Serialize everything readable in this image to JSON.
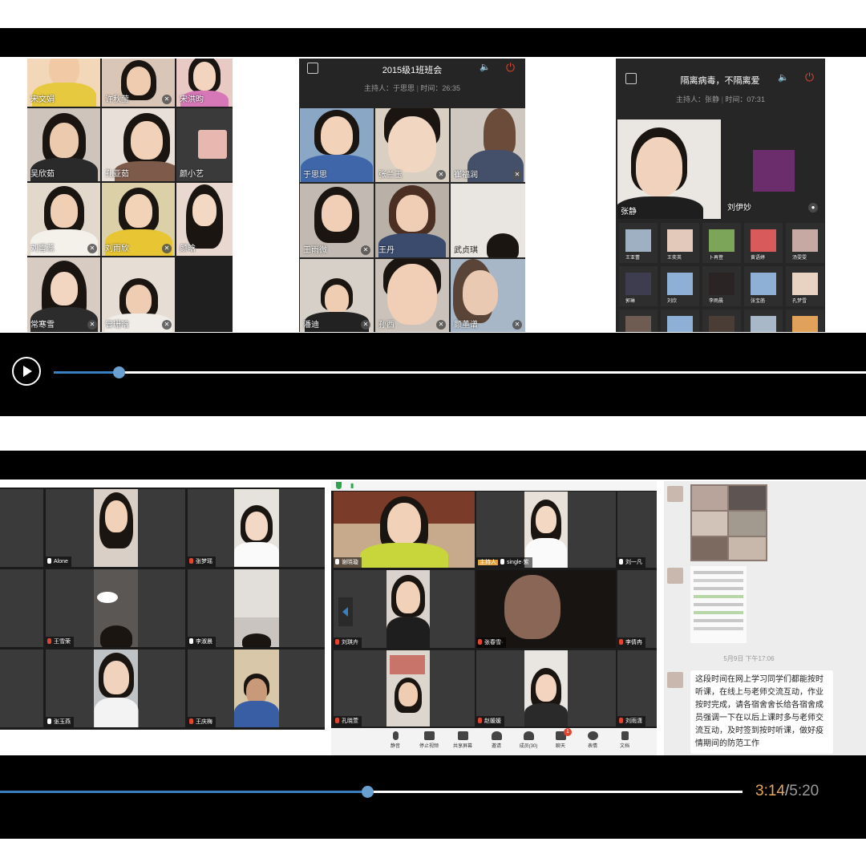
{
  "top_player": {
    "screen1": {
      "names": [
        "宋文娟",
        "许秋莹",
        "宋洪昀",
        "吴欣茹",
        "孔亚茹",
        "颜小艺",
        "刘雪蕊",
        "刘雨欣",
        "颜晗",
        "常寒雪",
        "曾珊晗"
      ]
    },
    "screen2": {
      "title": "2015级1班班会",
      "host": "主持人：于思思",
      "time": "时间：26:35",
      "names": [
        "于思思",
        "张兰玉",
        "崔福润",
        "王雨微",
        "王丹",
        "武贞琪",
        "潘迪",
        "孙西",
        "颜董谱"
      ]
    },
    "screen3": {
      "title": "隔离病毒，不隔离爱",
      "host": "主持人：张静",
      "time": "时间：07:31",
      "big_names": [
        "张静",
        "刘伊妙"
      ],
      "grid_names": [
        "王亚蕾",
        "王奕英",
        "卜再萱",
        "黄语婷",
        "汤雯雯",
        "郭琳",
        "刘欣",
        "李雨晨",
        "张宝菡",
        "孔梦雪"
      ]
    },
    "progress": 0.08
  },
  "bottom_player": {
    "screen4": {
      "names": [
        "Alone",
        "张梦瑶",
        "王雪荣",
        "李淑晨",
        "张玉燕",
        "王庆梅"
      ]
    },
    "screen5": {
      "names": [
        "谢晓璇",
        "主持人",
        "single·紫",
        "刘一凡",
        "刘琪卉",
        "张春雪·",
        "李倩冉",
        "孔晓萱",
        "赵媛媛",
        "刘雨潇"
      ],
      "toolbar": [
        "静音",
        "停止视频",
        "共享屏幕",
        "邀请",
        "成员(30)",
        "聊天",
        "表情",
        "文档"
      ],
      "chat_badge": "1"
    },
    "screen6": {
      "timestamp": "5月9日 下午17:06",
      "message": "这段时间在网上学习同学们都能按时听课，在线上与老师交流互动，作业按时完成，请各宿舍舍长给各宿舍成员强调一下在以后上课时多与老师交流互动，及时签到按时听课，做好疫情期间的防范工作"
    },
    "current_time": "3:14",
    "separator": "/",
    "total_time": "5:20",
    "progress": 0.495
  },
  "colors": {
    "progress": "#3a7fbf",
    "time_current": "#e8a95c",
    "time_total": "#9a9a9a",
    "hangup": "#e0452f"
  }
}
